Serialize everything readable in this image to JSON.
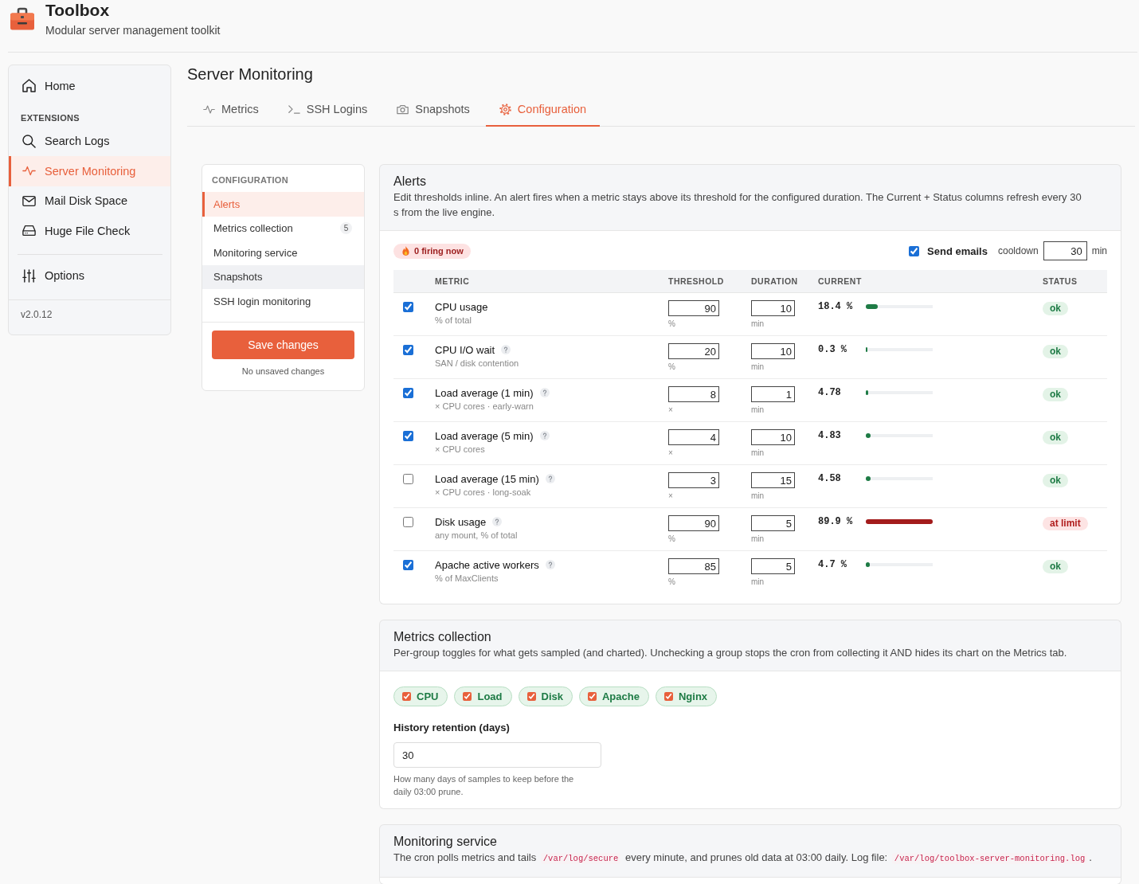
{
  "app": {
    "title": "Toolbox",
    "subtitle": "Modular server management toolkit"
  },
  "sidebar": {
    "items": [
      {
        "label": "Home",
        "kind": "home",
        "selected": false
      }
    ],
    "section": "EXTENSIONS",
    "extensions": [
      {
        "label": "Search Logs",
        "kind": "search",
        "selected": false
      },
      {
        "label": "Server Monitoring",
        "kind": "pulse",
        "selected": true
      },
      {
        "label": "Mail Disk Space",
        "kind": "mail",
        "selected": false
      },
      {
        "label": "Huge File Check",
        "kind": "drive",
        "selected": false
      }
    ],
    "footer_items": [
      {
        "label": "Options",
        "kind": "sliders",
        "selected": false
      }
    ],
    "version": "v2.0.12"
  },
  "page": {
    "title": "Server Monitoring"
  },
  "tabs": [
    {
      "label": "Metrics",
      "kind": "pulse",
      "selected": false
    },
    {
      "label": "SSH Logins",
      "kind": "terminal",
      "selected": false
    },
    {
      "label": "Snapshots",
      "kind": "camera",
      "selected": false
    },
    {
      "label": "Configuration",
      "kind": "gear",
      "selected": true
    }
  ],
  "config_nav": {
    "title": "CONFIGURATION",
    "items": [
      {
        "label": "Alerts",
        "selected": true,
        "hovered": false
      },
      {
        "label": "Metrics collection",
        "count": "5",
        "selected": false,
        "hovered": false
      },
      {
        "label": "Monitoring service",
        "selected": false,
        "hovered": false
      },
      {
        "label": "Snapshots",
        "selected": false,
        "hovered": true
      },
      {
        "label": "SSH login monitoring",
        "selected": false,
        "hovered": false
      }
    ],
    "save_button": "Save changes",
    "save_status": "No unsaved changes"
  },
  "alerts": {
    "title": "Alerts",
    "description": "Edit thresholds inline. An alert fires when a metric stays above its threshold for the configured duration. The Current + Status columns refresh every 30 s from the live engine.",
    "firing": "0 firing now",
    "send_emails": {
      "label": "Send emails",
      "checked": true
    },
    "cooldown": {
      "label": "cooldown",
      "value": "30",
      "unit": "min"
    },
    "columns": [
      "METRIC",
      "THRESHOLD",
      "DURATION",
      "CURRENT",
      "STATUS"
    ],
    "rows": [
      {
        "enabled": true,
        "name": "CPU usage",
        "help": false,
        "note": "% of total",
        "threshold": "90",
        "threshold_unit": "%",
        "duration": "10",
        "duration_unit": "min",
        "current": "18.4 %",
        "level": 0.18,
        "status": {
          "label": "ok",
          "kind": "ok"
        }
      },
      {
        "enabled": true,
        "name": "CPU I/O wait",
        "help": true,
        "note": "SAN / disk contention",
        "threshold": "20",
        "threshold_unit": "%",
        "duration": "10",
        "duration_unit": "min",
        "current": "0.3 %",
        "level": 0.02,
        "status": {
          "label": "ok",
          "kind": "ok"
        }
      },
      {
        "enabled": true,
        "name": "Load average (1 min)",
        "help": true,
        "note": "× CPU cores · early-warn",
        "threshold": "8",
        "threshold_unit": "×",
        "duration": "1",
        "duration_unit": "min",
        "current": "4.78",
        "level": 0.03,
        "status": {
          "label": "ok",
          "kind": "ok"
        }
      },
      {
        "enabled": true,
        "name": "Load average (5 min)",
        "help": true,
        "note": "× CPU cores",
        "threshold": "4",
        "threshold_unit": "×",
        "duration": "10",
        "duration_unit": "min",
        "current": "4.83",
        "level": 0.07,
        "status": {
          "label": "ok",
          "kind": "ok"
        }
      },
      {
        "enabled": false,
        "name": "Load average (15 min)",
        "help": true,
        "note": "× CPU cores · long-soak",
        "threshold": "3",
        "threshold_unit": "×",
        "duration": "15",
        "duration_unit": "min",
        "current": "4.58",
        "level": 0.07,
        "status": {
          "label": "ok",
          "kind": "ok"
        }
      },
      {
        "enabled": false,
        "name": "Disk usage",
        "help": true,
        "note": "any mount, % of total",
        "threshold": "90",
        "threshold_unit": "%",
        "duration": "5",
        "duration_unit": "min",
        "current": "89.9 %",
        "level": 1,
        "status": {
          "label": "at limit",
          "kind": "at_limit"
        }
      },
      {
        "enabled": true,
        "name": "Apache active workers",
        "help": true,
        "note": "% of MaxClients",
        "threshold": "85",
        "threshold_unit": "%",
        "duration": "5",
        "duration_unit": "min",
        "current": "4.7 %",
        "level": 0.06,
        "status": {
          "label": "ok",
          "kind": "ok"
        }
      }
    ]
  },
  "metrics_collection": {
    "title": "Metrics collection",
    "description": "Per-group toggles for what gets sampled (and charted). Unchecking a group stops the cron from collecting it AND hides its chart on the Metrics tab.",
    "groups": [
      {
        "label": "CPU",
        "checked": true
      },
      {
        "label": "Load",
        "checked": true
      },
      {
        "label": "Disk",
        "checked": true
      },
      {
        "label": "Apache",
        "checked": true
      },
      {
        "label": "Nginx",
        "checked": true
      }
    ],
    "retention": {
      "label": "History retention (days)",
      "value": "30",
      "hint": "How many days of samples to keep before the daily 03:00 prune."
    }
  },
  "monitoring_service": {
    "title": "Monitoring service",
    "description_parts": [
      {
        "kind": "text",
        "text": "The cron polls metrics and tails "
      },
      {
        "kind": "code",
        "text": "/var/log/secure"
      },
      {
        "kind": "text",
        "text": " every minute, and prunes old data at 03:00 daily. Log file: "
      },
      {
        "kind": "code",
        "text": "/var/log/toolbox-server-monitoring.log"
      },
      {
        "kind": "text",
        "text": "."
      }
    ]
  }
}
